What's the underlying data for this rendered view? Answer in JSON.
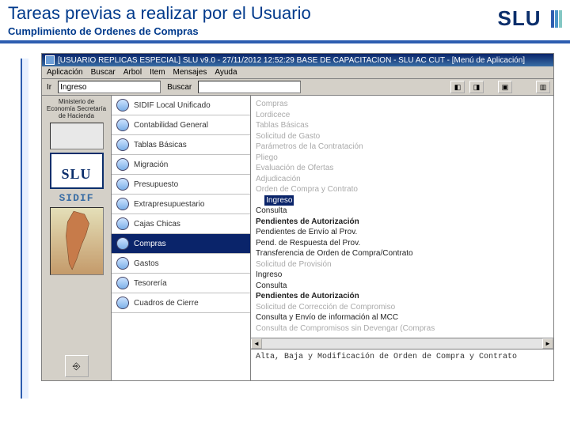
{
  "header": {
    "title": "Tareas previas a realizar por el Usuario",
    "subtitle": "Cumplimiento de Ordenes de Compras",
    "logo_text": "SLU"
  },
  "window": {
    "title": "[USUARIO REPLICAS ESPECIAL] SLU v9.0 - 27/11/2012 12:52:29 BASE DE CAPACITACION - SLU AC CUT - [Menú de Aplicación]"
  },
  "menubar": {
    "items": [
      "Aplicación",
      "Buscar",
      "Arbol",
      "Item",
      "Mensajes",
      "Ayuda"
    ]
  },
  "toolbar": {
    "ir_label": "Ir",
    "ir_value": "Ingreso",
    "buscar_label": "Buscar",
    "buscar_value": ""
  },
  "left_panel": {
    "ministry": "Ministerio de Economía Secretaría de Hacienda",
    "slu_text": "SLU",
    "sidif": "SIDIF"
  },
  "modules": [
    {
      "label": "SIDIF Local Unificado"
    },
    {
      "label": "Contabilidad General"
    },
    {
      "label": "Tablas Básicas"
    },
    {
      "label": "Migración"
    },
    {
      "label": "Presupuesto"
    },
    {
      "label": "Extrapresupuestario"
    },
    {
      "label": "Cajas Chicas"
    },
    {
      "label": "Compras",
      "selected": true
    },
    {
      "label": "Gastos"
    },
    {
      "label": "Tesorería"
    },
    {
      "label": "Cuadros de Cierre"
    }
  ],
  "tree": {
    "lines": [
      {
        "t": "Compras",
        "cls": "dim"
      },
      {
        "t": "  Lordicece",
        "cls": "dim"
      },
      {
        "t": "  Tablas Básicas",
        "cls": "dim"
      },
      {
        "t": "  Solicitud de Gasto",
        "cls": "dim"
      },
      {
        "t": "  Parámetros de la Contratación",
        "cls": "dim"
      },
      {
        "t": "  Pliego",
        "cls": "dim"
      },
      {
        "t": "  Evaluación de Ofertas",
        "cls": "dim"
      },
      {
        "t": "  Adjudicación",
        "cls": "dim"
      },
      {
        "t": "  Orden de Compra y Contrato",
        "cls": "dim"
      },
      {
        "t": "    Ingreso",
        "cls": "sel"
      },
      {
        "t": "    Consulta",
        "cls": ""
      },
      {
        "t": "    Pendientes de Autorización",
        "cls": "bold"
      },
      {
        "t": "    Pendientes de Envío al Prov.",
        "cls": ""
      },
      {
        "t": "    Pend. de Respuesta del Prov.",
        "cls": ""
      },
      {
        "t": "    Transferencia de Orden de Compra/Contrato",
        "cls": ""
      },
      {
        "t": "  Solicitud de Provisión",
        "cls": "dim"
      },
      {
        "t": "    Ingreso",
        "cls": ""
      },
      {
        "t": "    Consulta",
        "cls": ""
      },
      {
        "t": "    Pendientes de Autorización",
        "cls": "bold"
      },
      {
        "t": "  Solicitud de Corrección de Compromiso",
        "cls": "dim"
      },
      {
        "t": "  Consulta y Envío de información al MCC",
        "cls": ""
      },
      {
        "t": "  Consulta de Compromisos sin Devengar (Compras",
        "cls": "dim"
      }
    ]
  },
  "description": "Alta, Baja y Modificación de Orden de Compra y Contrato"
}
